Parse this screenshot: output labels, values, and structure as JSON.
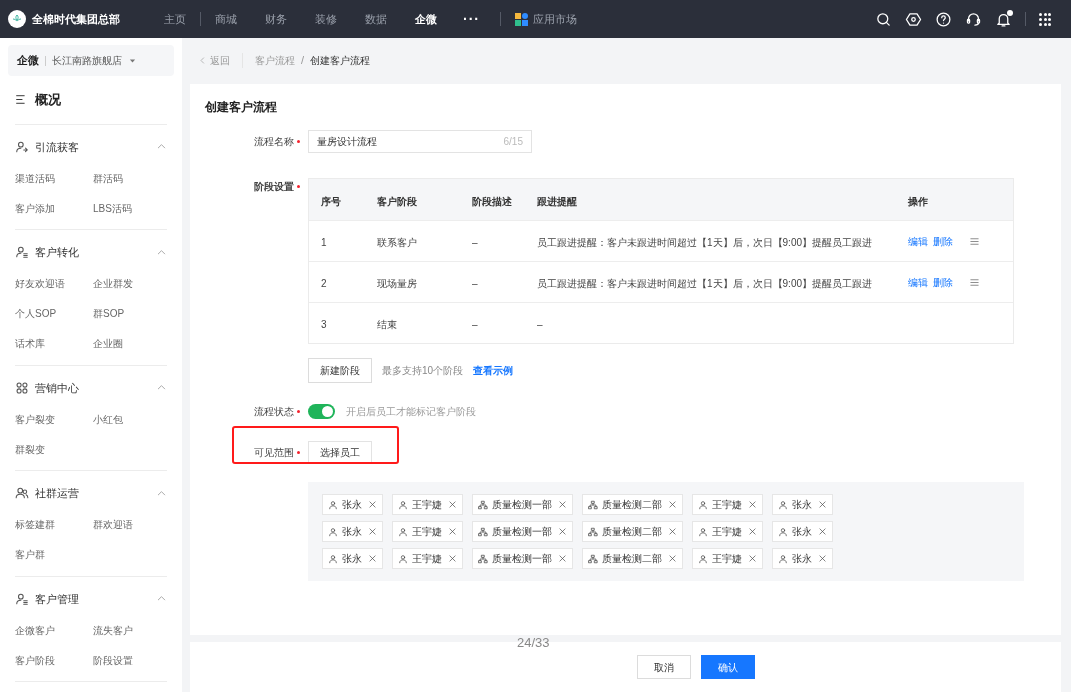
{
  "top_bar": {
    "brand": "全棉时代集团总部",
    "nav": [
      {
        "label": "主页",
        "selected": false
      },
      {
        "label": "商城",
        "selected": false
      },
      {
        "label": "财务",
        "selected": false
      },
      {
        "label": "装修",
        "selected": false
      },
      {
        "label": "数据",
        "selected": false
      },
      {
        "label": "企微",
        "selected": true
      }
    ],
    "more": "···",
    "app_market": "应用市场",
    "notification_dot": true
  },
  "sidebar": {
    "app": "企微",
    "store": "长江南路旗舰店",
    "overview": "概况",
    "groups": [
      {
        "title": "引流获客",
        "expanded": true,
        "items": [
          "渠道活码",
          "群活码",
          "客户添加",
          "LBS活码"
        ]
      },
      {
        "title": "客户转化",
        "expanded": true,
        "items": [
          "好友欢迎语",
          "企业群发",
          "个人SOP",
          "群SOP",
          "话术库",
          "企业圈"
        ]
      },
      {
        "title": "营销中心",
        "expanded": true,
        "items": [
          "客户裂变",
          "小红包",
          "群裂变"
        ]
      },
      {
        "title": "社群运营",
        "expanded": true,
        "items": [
          "标签建群",
          "群欢迎语",
          "客户群"
        ]
      },
      {
        "title": "客户管理",
        "expanded": true,
        "items": [
          "企微客户",
          "流失客户",
          "客户阶段",
          "阶段设置"
        ]
      }
    ]
  },
  "breadcrumb": {
    "back": "返回",
    "separator": "/",
    "items": [
      "客户流程",
      "创建客户流程"
    ]
  },
  "form": {
    "title": "创建客户流程",
    "name": {
      "label": "流程名称",
      "required": true,
      "value": "量房设计流程",
      "counter": "6/15"
    },
    "stages": {
      "label": "阶段设置",
      "required": true,
      "columns": [
        "序号",
        "客户阶段",
        "阶段描述",
        "跟进提醒",
        "操作"
      ],
      "rows": [
        {
          "index": "1",
          "stage": "联系客户",
          "description": "–",
          "reminder": "员工跟进提醒：客户未跟进时间超过【1天】后，次日【9:00】提醒员工跟进",
          "actions": [
            "编辑",
            "删除"
          ],
          "draggable": true
        },
        {
          "index": "2",
          "stage": "现场量房",
          "description": "–",
          "reminder": "员工跟进提醒：客户未跟进时间超过【1天】后，次日【9:00】提醒员工跟进",
          "actions": [
            "编辑",
            "删除"
          ],
          "draggable": true
        },
        {
          "index": "3",
          "stage": "结束",
          "description": "–",
          "reminder": "–",
          "actions": [],
          "draggable": false
        }
      ],
      "add_button": "新建阶段",
      "hint": "最多支持10个阶段",
      "example_link": "查看示例"
    },
    "status": {
      "label": "流程状态",
      "required": true,
      "on": true,
      "hint": "开启后员工才能标记客户阶段"
    },
    "scope": {
      "label": "可见范围",
      "required": true,
      "button": "选择员工",
      "highlighted": true,
      "tag_rows": [
        [
          {
            "kind": "person",
            "label": "张永"
          },
          {
            "kind": "person",
            "label": "王宇婕"
          },
          {
            "kind": "department",
            "label": "质量检测一部"
          },
          {
            "kind": "department",
            "label": "质量检测二部"
          },
          {
            "kind": "person",
            "label": "王宇婕"
          },
          {
            "kind": "person",
            "label": "张永"
          }
        ],
        [
          {
            "kind": "person",
            "label": "张永"
          },
          {
            "kind": "person",
            "label": "王宇婕"
          },
          {
            "kind": "department",
            "label": "质量检测一部"
          },
          {
            "kind": "department",
            "label": "质量检测二部"
          },
          {
            "kind": "person",
            "label": "王宇婕"
          },
          {
            "kind": "person",
            "label": "张永"
          }
        ],
        [
          {
            "kind": "person",
            "label": "张永"
          },
          {
            "kind": "person",
            "label": "王宇婕"
          },
          {
            "kind": "department",
            "label": "质量检测一部"
          },
          {
            "kind": "department",
            "label": "质量检测二部"
          },
          {
            "kind": "person",
            "label": "王宇婕"
          },
          {
            "kind": "person",
            "label": "张永"
          }
        ]
      ]
    }
  },
  "footer": {
    "cancel": "取消",
    "confirm": "确认"
  },
  "page_counter": "24/33"
}
